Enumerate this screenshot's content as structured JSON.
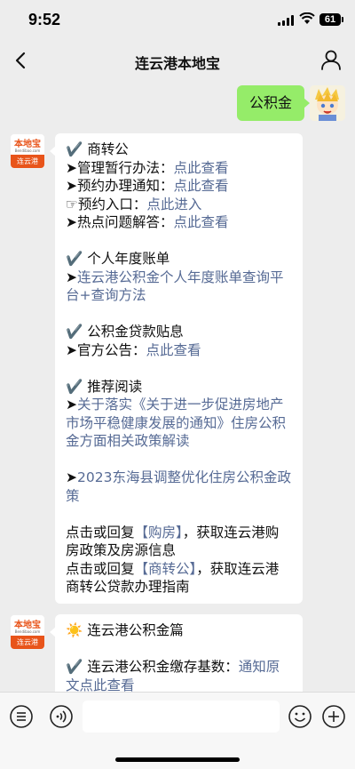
{
  "status": {
    "time": "9:52",
    "battery": "61"
  },
  "nav": {
    "title": "连云港本地宝"
  },
  "me": {
    "message": "公积金"
  },
  "bot": {
    "logo_top": "本地宝",
    "logo_sub": "Bendibao.com",
    "logo_bottom": "连云港"
  },
  "msg1": {
    "s1_title": "✔️ 商转公",
    "s1_l1_pre": "➤管理暂行办法：",
    "s1_l1_link": "点此查看",
    "s1_l2_pre": "➤预约办理通知：",
    "s1_l2_link": "点此查看",
    "s1_l3_pre": "☞预约入口：",
    "s1_l3_link": "点此进入",
    "s1_l4_pre": "➤热点问题解答：",
    "s1_l4_link": "点此查看",
    "s2_title": "✔️ 个人年度账单",
    "s2_pre": "➤",
    "s2_link": "连云港公积金个人年度账单查询平台+查询方法",
    "s3_title": "✔️ 公积金贷款贴息",
    "s3_pre": "➤官方公告：",
    "s3_link": "点此查看",
    "s4_title": "✔️ 推荐阅读",
    "s4_a_pre": "➤",
    "s4_a_link": "关于落实《关于进一步促进房地产市场平稳健康发展的通知》住房公积金方面相关政策解读",
    "s4_b_pre": "➤",
    "s4_b_link": "2023东海县调整优化住房公积金政策",
    "r1_pre": "点击或回复",
    "r1_link": "【购房】",
    "r1_post": "，获取连云港购房政策及房源信息",
    "r2_pre": "点击或回复",
    "r2_link": "【商转公】",
    "r2_post": "，获取连云港商转公贷款办理指南"
  },
  "msg2": {
    "title": "☀️ 连云港公积金篇",
    "l1_pre": "✔️ 连云港公积金缴存基数：",
    "l1_link": "通知原文点此查看"
  },
  "icons": {
    "back": "back-chevron-icon",
    "user": "user-profile-icon",
    "menu": "menu-list-icon",
    "voice": "voice-icon",
    "emoji": "emoji-icon",
    "plus": "plus-icon"
  },
  "colors": {
    "link": "#576b95",
    "my_bubble": "#95ec69",
    "brand": "#e8541a"
  }
}
